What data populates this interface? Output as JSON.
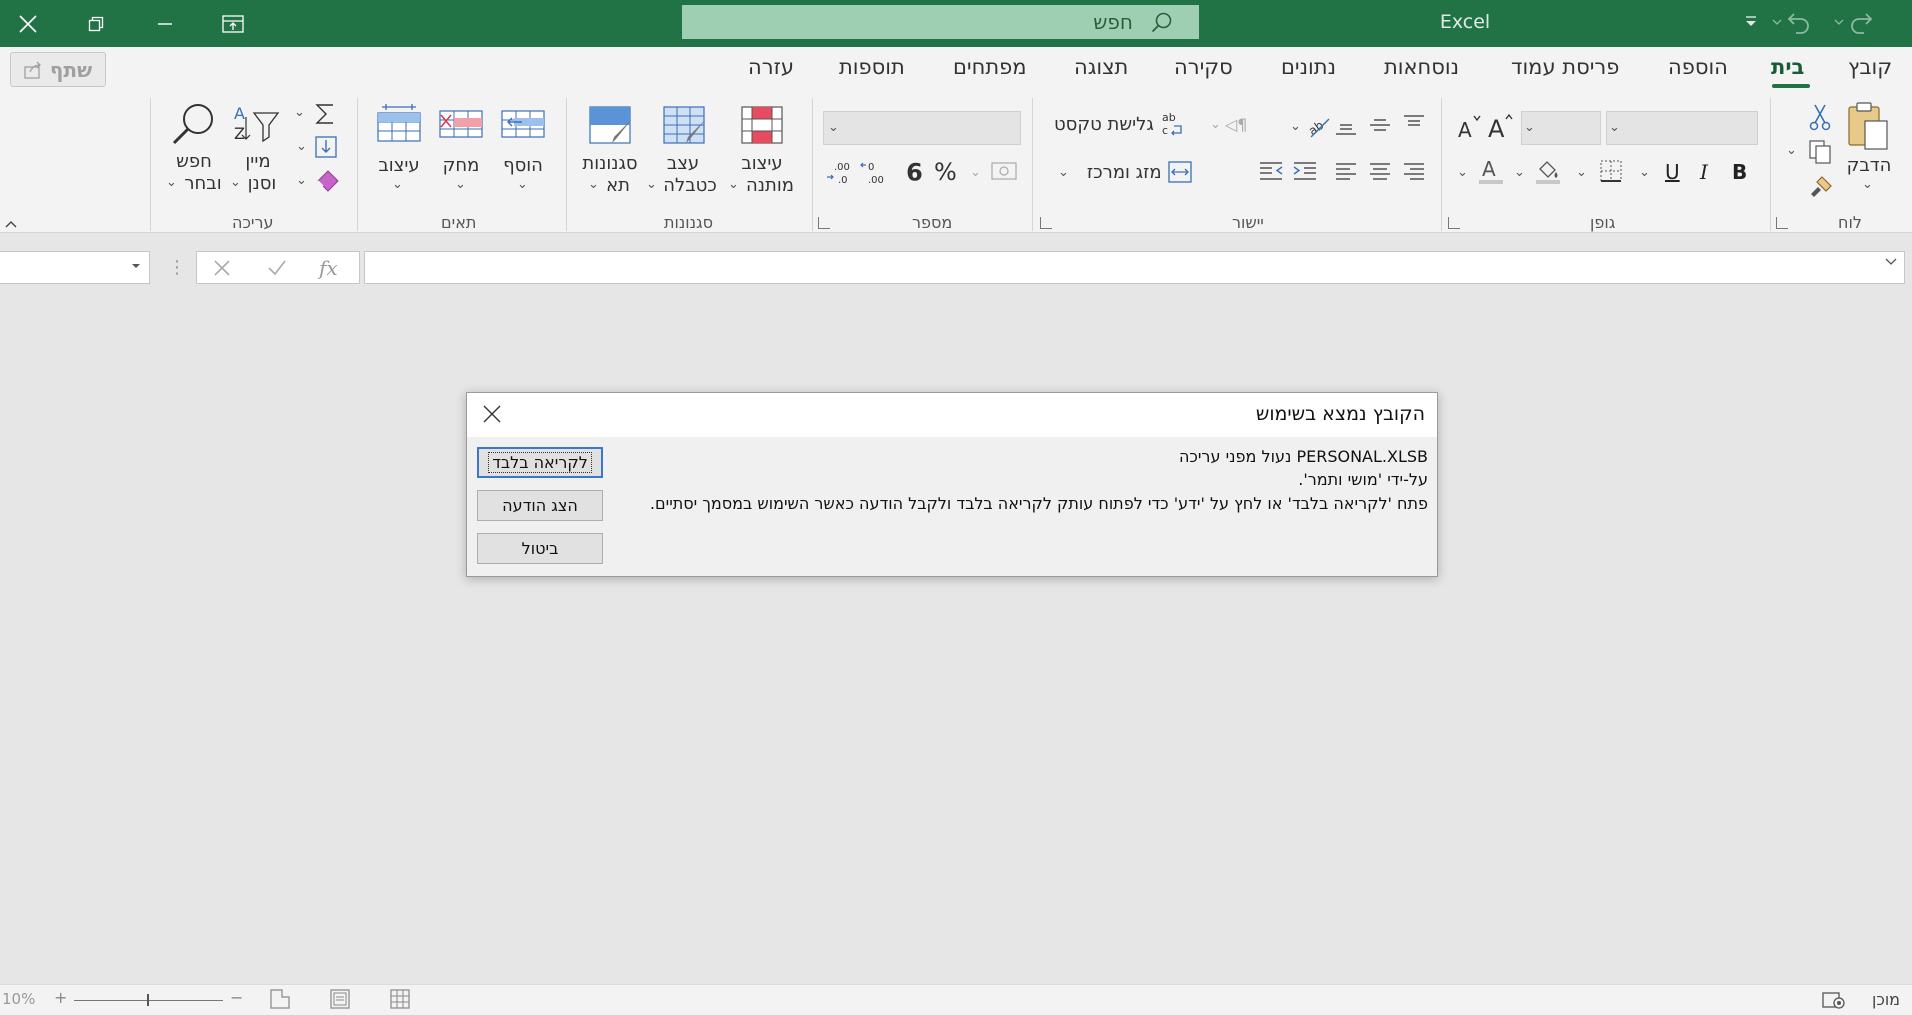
{
  "window": {
    "app_title": "Excel",
    "search_placeholder": "חפש"
  },
  "ribbon": {
    "tabs": [
      "קובץ",
      "בית",
      "הוספה",
      "פריסת עמוד",
      "נוסחאות",
      "נתונים",
      "סקירה",
      "תצוגה",
      "מפתחים",
      "תוספות",
      "עזרה"
    ],
    "active_tab": "בית",
    "share_label": "שתף",
    "groups": {
      "clipboard": {
        "label": "לוח",
        "paste": "הדבק"
      },
      "font": {
        "label": "גופן",
        "bold": "B",
        "italic": "I",
        "underline": "U",
        "font_name": "",
        "font_size": ""
      },
      "alignment": {
        "label": "יישור",
        "wrap_text": "גלישת טקסט",
        "merge_center": "מזג ומרכז"
      },
      "number": {
        "label": "מספר",
        "percent": "%",
        "comma": "9",
        "format_value": ""
      },
      "styles": {
        "label": "סגנונות",
        "conditional_line1": "עיצוב",
        "conditional_line2": "מותנה",
        "table_line1": "עצב",
        "table_line2": "כטבלה",
        "cell_line1": "סגנונות",
        "cell_line2": "תא"
      },
      "cells": {
        "label": "תאים",
        "insert": "הוסף",
        "delete": "מחק",
        "format": "עיצוב"
      },
      "editing": {
        "label": "עריכה",
        "sort_line1": "מיין",
        "sort_line2": "וסנן",
        "find_line1": "חפש",
        "find_line2": "ובחר"
      }
    }
  },
  "formula_bar": {
    "name_box": "",
    "fx": "fx",
    "formula": ""
  },
  "dialog": {
    "title": "הקובץ נמצא בשימוש",
    "line1": "PERSONAL.XLSB נעול מפני עריכה",
    "line2": "על-ידי 'מושי ותמר'.",
    "line3": "פתח 'לקריאה בלבד' או לחץ על 'ידע' כדי לפתוח עותק לקריאה בלבד ולקבל הודעה כאשר השימוש במסמך יסתיים.",
    "btn_readonly": "לקריאה בלבד",
    "btn_notify": "הצג הודעה",
    "btn_cancel": "ביטול"
  },
  "status_bar": {
    "ready": "מוכן",
    "zoom": "10%",
    "zoom_minus": "−",
    "zoom_plus": "+"
  },
  "colors": {
    "title_bar": "#217346",
    "accent": "#185c37",
    "dialog_focus": "#3c78c8"
  }
}
